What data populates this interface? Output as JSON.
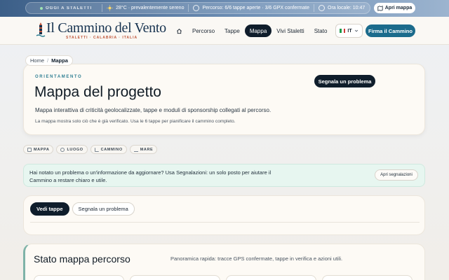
{
  "topbar": {
    "today_label": "OGGI A STALETTI",
    "weather": "28°C · prevalentemente sereno",
    "route": "Percorso: 6/6 tappe aperte · 3/6 GPX confermate",
    "local_time": "Ora locale: 10:47",
    "open_map_label": "Apri mappa"
  },
  "header": {
    "logo_title": "Il Cammino del Vento",
    "logo_subtitle": "STALETTI · CALABRIA · ITALIA",
    "nav": [
      {
        "label": "Home",
        "icon": "home-icon"
      },
      {
        "label": "Percorso"
      },
      {
        "label": "Tappe"
      },
      {
        "label": "Mappa",
        "active": true
      },
      {
        "label": "Vivi Staletti"
      },
      {
        "label": "Stato"
      }
    ],
    "language": "IT",
    "cta_label": "Firma il Cammino"
  },
  "breadcrumb": {
    "home": "Home",
    "separator": "/",
    "current": "Mappa"
  },
  "hero": {
    "eyebrow": "ORIENTAMENTO",
    "title": "Mappa del progetto",
    "description": "Mappa interattiva di criticità geolocalizzate, tappe e moduli di sponsorship collegati al percorso.",
    "note": "La mappa mostra solo ciò che è già verificato. Usa le 6 tappe per pianificare il cammino completo.",
    "report_button": "Segnala un problema"
  },
  "chips": [
    {
      "label": "MAPPA",
      "icon": "map-icon"
    },
    {
      "label": "LUOGO",
      "icon": "pin-icon"
    },
    {
      "label": "CAMMINO",
      "icon": "walker-icon"
    },
    {
      "label": "MARE",
      "icon": "wave-icon"
    }
  ],
  "notice": {
    "text": "Hai notato un problema o un'informazione da aggiornare? Usa Segnalazioni: un solo posto per aiutare il Cammino a restare chiaro e utile.",
    "button": "Apri segnalazioni"
  },
  "tabs": [
    {
      "label": "Vedi tappe",
      "active": true
    },
    {
      "label": "Segnala un problema"
    }
  ],
  "status": {
    "title": "Stato mappa percorso",
    "subtitle": "Panoramica rapida: tracce GPS confermate, tappe in verifica e azioni utili."
  },
  "colors": {
    "navy": "#0f1d2b",
    "teal_cta": "#1b6b8c",
    "accent_red": "#c0563a",
    "notice_bg": "#e7f6f0"
  }
}
